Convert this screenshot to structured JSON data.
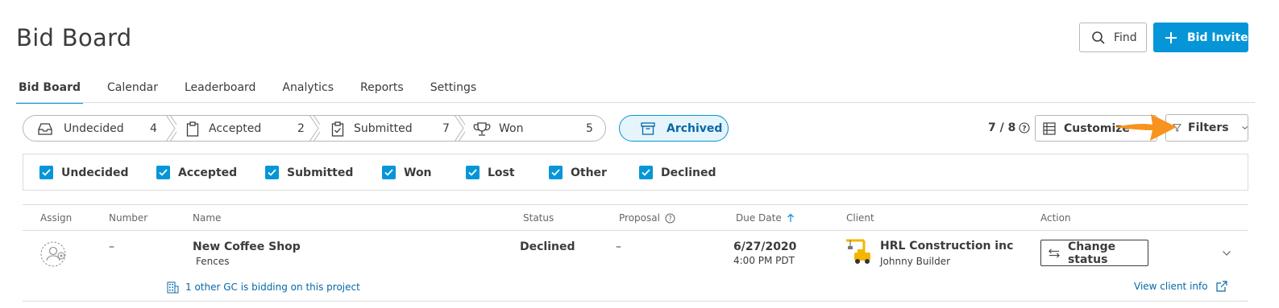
{
  "page": {
    "title": "Bid Board"
  },
  "header": {
    "find_label": "Find",
    "invite_label": "Bid Invite"
  },
  "tabs": [
    {
      "label": "Bid Board",
      "active": true
    },
    {
      "label": "Calendar",
      "active": false
    },
    {
      "label": "Leaderboard",
      "active": false
    },
    {
      "label": "Analytics",
      "active": false
    },
    {
      "label": "Reports",
      "active": false
    },
    {
      "label": "Settings",
      "active": false
    }
  ],
  "pipeline": [
    {
      "label": "Undecided",
      "count": "4",
      "icon": "inbox-icon"
    },
    {
      "label": "Accepted",
      "count": "2",
      "icon": "clipboard-icon"
    },
    {
      "label": "Submitted",
      "count": "7",
      "icon": "clipboard-check-icon"
    },
    {
      "label": "Won",
      "count": "5",
      "icon": "trophy-icon"
    }
  ],
  "archived_label": "Archived",
  "toolbar": {
    "count_label": "7 / 8",
    "customize_label": "Customize",
    "filters_label": "Filters"
  },
  "status_filters": [
    {
      "label": "Undecided",
      "checked": true
    },
    {
      "label": "Accepted",
      "checked": true
    },
    {
      "label": "Submitted",
      "checked": true
    },
    {
      "label": "Won",
      "checked": true
    },
    {
      "label": "Lost",
      "checked": true
    },
    {
      "label": "Other",
      "checked": true
    },
    {
      "label": "Declined",
      "checked": true
    }
  ],
  "columns": {
    "assign": "Assign",
    "number": "Number",
    "name": "Name",
    "status": "Status",
    "proposal": "Proposal",
    "due_date": "Due Date",
    "client": "Client",
    "action": "Action"
  },
  "rows": [
    {
      "number": "–",
      "name": "New Coffee Shop",
      "trade": "Fences",
      "status": "Declined",
      "proposal": "–",
      "due_date": "6/27/2020",
      "due_time": "4:00 PM PDT",
      "client_name": "HRL Construction inc",
      "client_contact": "Johnny Builder",
      "action_label": "Change status",
      "gc_note": "1 other GC is bidding on this project",
      "client_link": "View client info"
    }
  ],
  "colors": {
    "accent": "#0696d7",
    "link": "#0668a8",
    "annotation_arrow": "#f7931e"
  }
}
